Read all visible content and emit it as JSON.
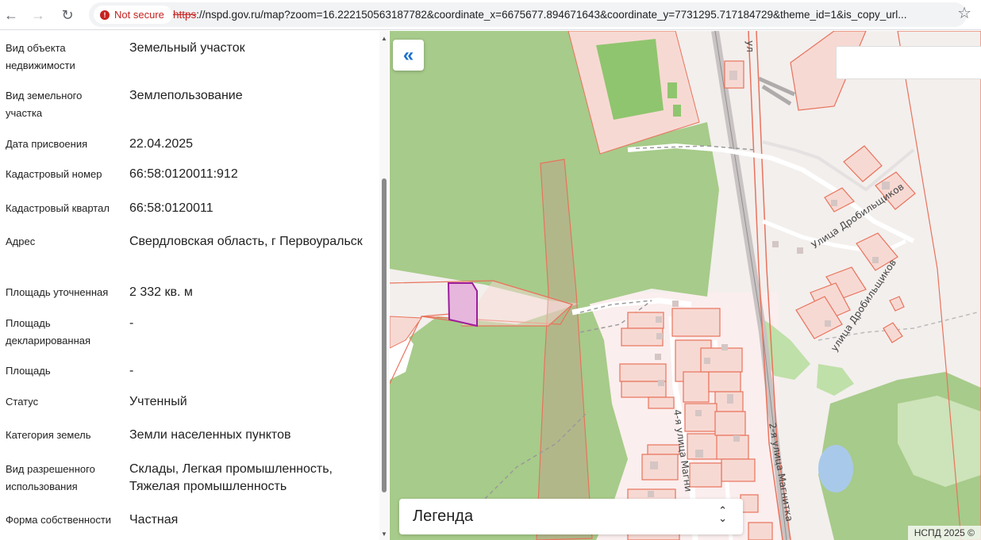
{
  "browser": {
    "security_label": "Not secure",
    "url_scheme": "https",
    "url_rest": "://nspd.gov.ru/map?zoom=16.222150563187782&coordinate_x=6675677.894671643&coordinate_y=7731295.717184729&theme_id=1&is_copy_url..."
  },
  "properties": [
    {
      "label": "Вид объекта недвижимости",
      "value": "Земельный участок"
    },
    {
      "label": "Вид земельного участка",
      "value": "Землепользование"
    },
    {
      "label": "Дата присвоения",
      "value": "22.04.2025"
    },
    {
      "label": "Кадастровый номер",
      "value": "66:58:0120011:912"
    },
    {
      "label": "Кадастровый квартал",
      "value": "66:58:0120011"
    },
    {
      "label": "Адрес",
      "value": "Свердловская область, г Первоуральск"
    },
    {
      "label": "Площадь уточненная",
      "value": "2 332 кв. м"
    },
    {
      "label": "Площадь декларированная",
      "value": "-"
    },
    {
      "label": "Площадь",
      "value": "-"
    },
    {
      "label": "Статус",
      "value": "Учтенный"
    },
    {
      "label": "Категория земель",
      "value": "Земли населенных пунктов"
    },
    {
      "label": "Вид разрешенного использования",
      "value": "Склады, Легкая промышленность, Тяжелая промышленность"
    },
    {
      "label": "Форма собственности",
      "value": "Частная"
    }
  ],
  "map": {
    "collapse_icon": "double-chevron-left-icon",
    "legend_label": "Легенда",
    "copyright": "НСПД 2025 ©",
    "streets": [
      "Улица Дробильщиков",
      "улица Дробильщиков",
      "4-я улица Магни",
      "2-я улица Магнитка",
      "ул"
    ],
    "colors": {
      "forest": "#a7cb8a",
      "parcel_stroke": "#e8735c",
      "parcel_fill": "#f7d9d3",
      "selected_parcel": "#9b1d9b",
      "link_blue": "#1a6fcf"
    }
  }
}
